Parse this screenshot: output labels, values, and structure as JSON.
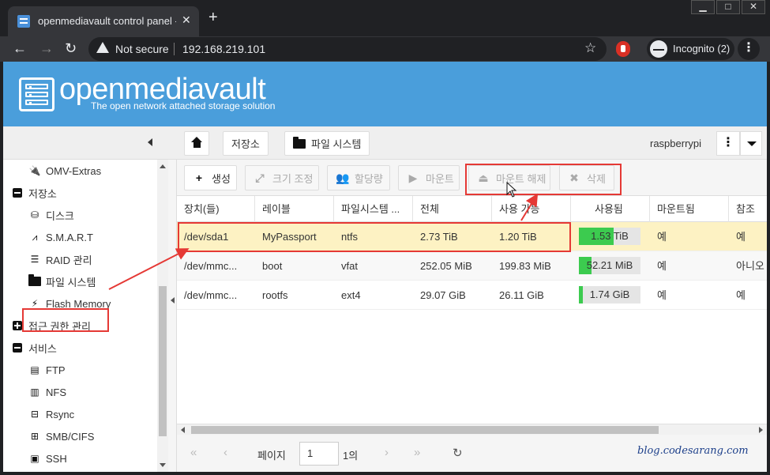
{
  "browser": {
    "tab_title": "openmediavault control panel - r",
    "tab_close": "✕",
    "new_tab": "+",
    "window_buttons": [
      "▁",
      "□",
      "✕"
    ],
    "back": "←",
    "forward": "→",
    "reload": "↻",
    "security_label": "Not secure",
    "url": "192.168.219.101",
    "star": "☆",
    "incognito_label": "Incognito (2)",
    "menu": "⋮"
  },
  "header": {
    "logo_text": "openmediavault",
    "tagline": "The open network attached storage solution"
  },
  "sidebar": {
    "items": [
      {
        "label": "OMV-Extras",
        "icon": "plug-icon",
        "glyph": "🔌"
      },
      {
        "label": "저장소",
        "icon": "collapse-icon"
      },
      {
        "label": "디스크",
        "icon": "disk-icon",
        "glyph": "⛁"
      },
      {
        "label": "S.M.A.R.T",
        "icon": "heartbeat-icon",
        "glyph": "⩘"
      },
      {
        "label": "RAID 관리",
        "icon": "database-icon",
        "glyph": "☰"
      },
      {
        "label": "파일 시스템",
        "icon": "folder-icon"
      },
      {
        "label": "Flash Memory",
        "icon": "bolt-icon",
        "glyph": "⚡"
      },
      {
        "label": "접근 권한 관리",
        "icon": "expand-icon"
      },
      {
        "label": "서비스",
        "icon": "collapse-icon"
      },
      {
        "label": "FTP",
        "icon": "ftp-icon",
        "glyph": "▤"
      },
      {
        "label": "NFS",
        "icon": "nfs-icon",
        "glyph": "▥"
      },
      {
        "label": "Rsync",
        "icon": "rsync-icon",
        "glyph": "⊟"
      },
      {
        "label": "SMB/CIFS",
        "icon": "windows-icon",
        "glyph": "⊞"
      },
      {
        "label": "SSH",
        "icon": "terminal-icon",
        "glyph": "▣"
      }
    ]
  },
  "breadcrumb": {
    "storage": "저장소",
    "filesystem": "파일 시스템",
    "user": "raspberrypi"
  },
  "actions": {
    "create": "생성",
    "resize": "크기 조정",
    "quota": "할당량",
    "mount": "마운트",
    "unmount": "마운트 해제",
    "delete": "삭제",
    "icons": {
      "create": "+",
      "resize": "⤢",
      "quota": "👥",
      "mount": "▶",
      "unmount": "⏏",
      "delete": "✖"
    }
  },
  "table": {
    "columns": [
      "장치(들)",
      "레이블",
      "파일시스템 ...",
      "전체",
      "사용 가능",
      "사용됨",
      "마운트됨",
      "참조"
    ],
    "rows": [
      {
        "device": "/dev/sda1",
        "label": "MyPassport",
        "fs": "ntfs",
        "total": "2.73 TiB",
        "available": "1.20 TiB",
        "used": "1.53 TiB",
        "used_fraction": 0.56,
        "mounted": "예",
        "referenced": "예"
      },
      {
        "device": "/dev/mmc...",
        "label": "boot",
        "fs": "vfat",
        "total": "252.05 MiB",
        "available": "199.83 MiB",
        "used": "52.21 MiB",
        "used_fraction": 0.21,
        "mounted": "예",
        "referenced": "아니오"
      },
      {
        "device": "/dev/mmc...",
        "label": "rootfs",
        "fs": "ext4",
        "total": "29.07 GiB",
        "available": "26.11 GiB",
        "used": "1.74 GiB",
        "used_fraction": 0.06,
        "mounted": "예",
        "referenced": "예"
      }
    ]
  },
  "pager": {
    "first": "«",
    "prev": "‹",
    "page_label": "페이지",
    "page_value": "1",
    "of_label": "1의",
    "next": "›",
    "last": "»",
    "refresh": "↻",
    "watermark": "blog.codesarang.com"
  },
  "colors": {
    "omv_blue": "#4a9edb",
    "selected_row": "#fdf2c3",
    "usage_green": "#3ccb4f",
    "highlight_red": "#e53935"
  }
}
